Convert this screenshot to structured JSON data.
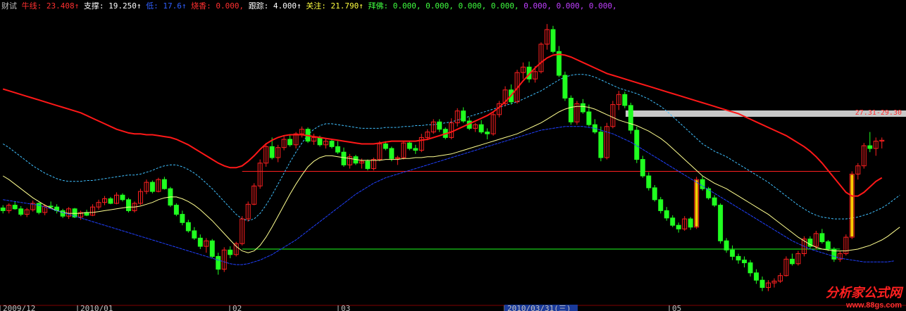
{
  "header": {
    "title": "财试",
    "items": [
      {
        "label": "牛线",
        "value": "23.408",
        "arrow": "↑",
        "color": "#ff3030"
      },
      {
        "label": "支撑",
        "value": "19.250",
        "arrow": "↑",
        "color": "#ffffff"
      },
      {
        "label": "低",
        "value": "17.6",
        "arrow": "↑",
        "color": "#3060ff"
      },
      {
        "label": "烧香",
        "value": "0.000",
        "arrow": ",",
        "color": "#ff3030"
      },
      {
        "label": "跟踪",
        "value": "4.000",
        "arrow": "↑",
        "color": "#ffffff"
      },
      {
        "label": "关注",
        "value": "21.790",
        "arrow": "↑",
        "color": "#ffff40"
      },
      {
        "label": "拜佛",
        "value": "0.000, 0.000, 0.000, 0.000,",
        "arrow": "",
        "color": "#40ff40"
      },
      {
        "label": "",
        "value": "0.000, 0.000, 0.000,",
        "arrow": "",
        "color": "#c040ff"
      }
    ]
  },
  "x_axis": {
    "ticks": [
      "2009/12",
      "2010/01",
      "02",
      "03",
      "2010/03/31(三)",
      "05"
    ]
  },
  "price_box_label": "27.31-29.30",
  "watermark": {
    "title": "分析家公式网",
    "url": "www.88gs.com"
  },
  "colors": {
    "up": "#ff2020",
    "down": "#20ff20",
    "special": "#ffcc00",
    "bull_line": "#ff1818",
    "support": "#ffff90",
    "low": "#2040ff",
    "track": "#40c0ff"
  },
  "chart_data": {
    "type": "candlestick",
    "ylim": [
      5,
      37
    ],
    "candles": [
      [
        15.5,
        15.8,
        14.9,
        15.2
      ],
      [
        15.2,
        16.0,
        14.9,
        15.8
      ],
      [
        15.8,
        16.2,
        15.3,
        15.4
      ],
      [
        15.4,
        15.7,
        14.6,
        14.8
      ],
      [
        14.8,
        15.5,
        14.5,
        15.3
      ],
      [
        15.3,
        16.3,
        15.1,
        16.0
      ],
      [
        16.0,
        16.1,
        14.8,
        15.0
      ],
      [
        15.0,
        15.9,
        14.7,
        15.7
      ],
      [
        15.7,
        16.2,
        15.5,
        15.6
      ],
      [
        15.6,
        15.9,
        14.9,
        15.2
      ],
      [
        15.2,
        15.4,
        14.4,
        14.6
      ],
      [
        14.6,
        15.6,
        14.3,
        15.4
      ],
      [
        15.4,
        15.5,
        14.4,
        14.5
      ],
      [
        14.5,
        15.2,
        14.2,
        15.0
      ],
      [
        15.0,
        15.3,
        14.6,
        14.7
      ],
      [
        14.7,
        15.9,
        14.6,
        15.6
      ],
      [
        15.6,
        16.4,
        15.3,
        16.1
      ],
      [
        16.1,
        16.8,
        15.8,
        16.5
      ],
      [
        16.5,
        16.7,
        15.9,
        16.0
      ],
      [
        16.0,
        17.2,
        15.9,
        16.9
      ],
      [
        16.9,
        17.1,
        16.2,
        16.4
      ],
      [
        16.4,
        16.6,
        15.0,
        15.2
      ],
      [
        15.2,
        16.2,
        15.0,
        16.0
      ],
      [
        16.0,
        17.6,
        15.8,
        17.3
      ],
      [
        17.3,
        18.6,
        17.0,
        18.3
      ],
      [
        18.3,
        18.5,
        17.1,
        17.3
      ],
      [
        17.3,
        18.8,
        17.2,
        18.6
      ],
      [
        18.6,
        18.9,
        17.5,
        17.6
      ],
      [
        17.6,
        17.8,
        15.6,
        15.8
      ],
      [
        15.8,
        16.0,
        14.6,
        14.8
      ],
      [
        14.8,
        15.2,
        13.6,
        13.9
      ],
      [
        13.9,
        14.2,
        12.8,
        13.0
      ],
      [
        13.0,
        13.4,
        12.0,
        12.2
      ],
      [
        12.2,
        12.6,
        11.0,
        11.3
      ],
      [
        11.3,
        12.2,
        10.6,
        11.9
      ],
      [
        11.9,
        12.1,
        10.0,
        10.2
      ],
      [
        10.2,
        10.6,
        8.2,
        8.8
      ],
      [
        8.8,
        11.2,
        8.5,
        10.9
      ],
      [
        10.9,
        11.3,
        10.0,
        10.4
      ],
      [
        10.4,
        11.8,
        10.2,
        11.6
      ],
      [
        11.6,
        14.6,
        11.4,
        14.3
      ],
      [
        14.3,
        16.2,
        14.0,
        15.9
      ],
      [
        15.9,
        18.2,
        15.8,
        17.9
      ],
      [
        17.9,
        20.8,
        17.6,
        20.4
      ],
      [
        20.4,
        22.6,
        20.0,
        22.2
      ],
      [
        22.2,
        23.2,
        20.8,
        21.0
      ],
      [
        21.0,
        22.4,
        20.5,
        22.1
      ],
      [
        22.1,
        23.4,
        21.8,
        23.0
      ],
      [
        23.0,
        23.5,
        22.2,
        22.4
      ],
      [
        22.4,
        23.8,
        22.0,
        23.6
      ],
      [
        23.6,
        24.4,
        23.2,
        24.1
      ],
      [
        24.1,
        24.3,
        22.6,
        22.8
      ],
      [
        22.8,
        23.6,
        22.4,
        23.2
      ],
      [
        23.2,
        23.4,
        22.2,
        22.4
      ],
      [
        22.4,
        23.1,
        22.0,
        22.8
      ],
      [
        22.8,
        23.0,
        22.0,
        22.2
      ],
      [
        22.2,
        22.8,
        21.4,
        21.6
      ],
      [
        21.6,
        22.1,
        20.0,
        20.2
      ],
      [
        20.2,
        21.4,
        19.8,
        21.1
      ],
      [
        21.1,
        21.3,
        20.2,
        20.4
      ],
      [
        20.4,
        20.9,
        19.8,
        20.6
      ],
      [
        20.6,
        20.8,
        19.6,
        19.8
      ],
      [
        19.8,
        21.0,
        19.6,
        20.8
      ],
      [
        20.8,
        22.8,
        20.6,
        22.5
      ],
      [
        22.5,
        22.8,
        21.8,
        22.0
      ],
      [
        22.0,
        22.2,
        20.6,
        20.9
      ],
      [
        20.9,
        21.2,
        20.2,
        21.0
      ],
      [
        21.0,
        22.8,
        20.8,
        22.6
      ],
      [
        22.6,
        22.8,
        21.8,
        22.0
      ],
      [
        22.0,
        22.4,
        21.4,
        21.8
      ],
      [
        21.8,
        23.6,
        21.6,
        23.2
      ],
      [
        23.2,
        24.1,
        22.9,
        23.8
      ],
      [
        23.8,
        25.2,
        23.6,
        24.9
      ],
      [
        24.9,
        25.2,
        23.8,
        24.1
      ],
      [
        24.1,
        24.3,
        23.0,
        23.2
      ],
      [
        23.2,
        25.3,
        23.0,
        24.8
      ],
      [
        24.8,
        26.4,
        24.4,
        26.1
      ],
      [
        26.1,
        26.5,
        24.8,
        25.0
      ],
      [
        25.0,
        25.4,
        24.0,
        24.2
      ],
      [
        24.2,
        24.8,
        23.8,
        24.6
      ],
      [
        24.6,
        25.1,
        23.6,
        23.8
      ],
      [
        23.8,
        24.2,
        23.0,
        23.6
      ],
      [
        23.6,
        26.0,
        23.4,
        25.7
      ],
      [
        25.7,
        27.2,
        25.4,
        26.9
      ],
      [
        26.9,
        28.8,
        26.6,
        28.4
      ],
      [
        28.4,
        29.0,
        26.8,
        27.1
      ],
      [
        27.1,
        30.6,
        26.9,
        30.3
      ],
      [
        30.3,
        31.4,
        29.6,
        30.9
      ],
      [
        30.9,
        31.5,
        29.2,
        29.6
      ],
      [
        29.6,
        31.0,
        29.2,
        30.4
      ],
      [
        30.4,
        33.6,
        30.2,
        33.4
      ],
      [
        33.4,
        35.6,
        32.8,
        35.0
      ],
      [
        35.0,
        35.4,
        32.4,
        32.6
      ],
      [
        32.6,
        33.2,
        29.8,
        30.0
      ],
      [
        30.0,
        30.4,
        27.2,
        27.5
      ],
      [
        27.5,
        27.8,
        24.6,
        24.9
      ],
      [
        24.9,
        27.2,
        24.6,
        26.9
      ],
      [
        26.9,
        27.4,
        25.8,
        26.0
      ],
      [
        26.0,
        26.8,
        24.4,
        24.6
      ],
      [
        24.6,
        25.2,
        23.6,
        23.8
      ],
      [
        23.8,
        24.4,
        20.6,
        21.0
      ],
      [
        21.0,
        24.8,
        20.8,
        24.4
      ],
      [
        24.4,
        27.2,
        24.2,
        26.8
      ],
      [
        26.8,
        28.3,
        26.2,
        27.9
      ],
      [
        27.9,
        28.2,
        26.4,
        26.7
      ],
      [
        26.7,
        27.0,
        23.6,
        24.0
      ],
      [
        24.0,
        24.4,
        20.4,
        20.8
      ],
      [
        20.8,
        21.2,
        18.8,
        19.0
      ],
      [
        19.0,
        19.4,
        17.4,
        17.7
      ],
      [
        17.7,
        18.0,
        16.2,
        16.4
      ],
      [
        16.4,
        16.7,
        14.9,
        15.2
      ],
      [
        15.2,
        15.6,
        14.1,
        14.4
      ],
      [
        14.4,
        14.7,
        13.4,
        13.6
      ],
      [
        13.6,
        13.9,
        12.8,
        13.2
      ],
      [
        13.2,
        14.6,
        13.0,
        14.3
      ],
      [
        14.3,
        14.5,
        13.1,
        13.4
      ],
      [
        13.4,
        18.9,
        13.2,
        18.6
      ],
      [
        18.6,
        19.0,
        17.4,
        17.6
      ],
      [
        17.6,
        17.8,
        16.4,
        16.6
      ],
      [
        16.6,
        16.9,
        15.6,
        15.8
      ],
      [
        15.8,
        16.0,
        11.6,
        11.9
      ],
      [
        11.9,
        12.2,
        10.6,
        10.9
      ],
      [
        10.9,
        11.4,
        9.8,
        10.2
      ],
      [
        10.2,
        10.5,
        9.4,
        9.8
      ],
      [
        9.8,
        10.2,
        9.0,
        9.5
      ],
      [
        9.5,
        9.8,
        8.0,
        8.4
      ],
      [
        8.4,
        8.8,
        7.2,
        7.6
      ],
      [
        7.6,
        8.0,
        6.4,
        6.8
      ],
      [
        6.8,
        7.6,
        6.4,
        7.3
      ],
      [
        7.3,
        7.8,
        6.8,
        7.5
      ],
      [
        7.5,
        8.4,
        7.3,
        8.1
      ],
      [
        8.1,
        10.2,
        8.0,
        9.9
      ],
      [
        9.9,
        10.5,
        9.2,
        9.4
      ],
      [
        9.4,
        10.8,
        9.2,
        10.5
      ],
      [
        10.5,
        12.4,
        10.2,
        12.1
      ],
      [
        12.1,
        12.4,
        11.0,
        11.3
      ],
      [
        11.3,
        13.0,
        11.0,
        12.7
      ],
      [
        12.7,
        13.2,
        11.6,
        11.8
      ],
      [
        11.8,
        12.0,
        10.8,
        11.0
      ],
      [
        11.0,
        11.2,
        9.6,
        9.9
      ],
      [
        9.9,
        10.8,
        9.6,
        10.5
      ],
      [
        10.5,
        12.6,
        10.3,
        12.3
      ],
      [
        12.3,
        19.5,
        12.1,
        19.2
      ],
      [
        19.2,
        20.4,
        18.6,
        20.1
      ],
      [
        20.1,
        22.6,
        19.8,
        22.3
      ],
      [
        22.3,
        23.8,
        21.6,
        22.0
      ],
      [
        22.0,
        23.2,
        21.2,
        22.8
      ],
      [
        22.8,
        23.2,
        22.0,
        22.9
      ]
    ],
    "series": [
      {
        "name": "牛线",
        "values": [
          28.5,
          28.3,
          28.1,
          27.9,
          27.7,
          27.5,
          27.3,
          27.1,
          26.9,
          26.7,
          26.5,
          26.3,
          26.1,
          25.9,
          25.6,
          25.3,
          25.0,
          24.7,
          24.4,
          24.1,
          23.9,
          23.7,
          23.6,
          23.6,
          23.5,
          23.5,
          23.4,
          23.3,
          23.2,
          23.0,
          22.7,
          22.4,
          22.0,
          21.6,
          21.2,
          20.8,
          20.4,
          20.1,
          19.9,
          19.9,
          20.1,
          20.6,
          21.2,
          21.9,
          22.5,
          22.9,
          23.2,
          23.4,
          23.5,
          23.5,
          23.5,
          23.4,
          23.3,
          23.2,
          23.1,
          23.0,
          22.9,
          22.8,
          22.7,
          22.6,
          22.5,
          22.5,
          22.5,
          22.6,
          22.7,
          22.8,
          22.8,
          22.8,
          22.8,
          22.8,
          22.9,
          23.0,
          23.2,
          23.4,
          23.6,
          23.8,
          24.1,
          24.4,
          24.7,
          25.0,
          25.3,
          25.6,
          26.0,
          26.5,
          27.1,
          27.8,
          28.6,
          29.4,
          30.1,
          30.8,
          31.4,
          31.9,
          32.2,
          32.3,
          32.2,
          32.0,
          31.7,
          31.4,
          31.1,
          30.8,
          30.5,
          30.2,
          30.0,
          29.8,
          29.6,
          29.4,
          29.2,
          29.0,
          28.8,
          28.6,
          28.4,
          28.2,
          28.0,
          27.8,
          27.6,
          27.4,
          27.2,
          27.0,
          26.8,
          26.6,
          26.4,
          26.2,
          26.0,
          25.8,
          25.5,
          25.2,
          24.9,
          24.6,
          24.3,
          24.0,
          23.7,
          23.4,
          23.0,
          22.6,
          22.2,
          21.7,
          21.1,
          20.4,
          19.6,
          18.8,
          18.0,
          17.2,
          16.8,
          16.8,
          17.2,
          17.8,
          18.4,
          18.8
        ]
      },
      {
        "name": "支撑",
        "values": [
          19.0,
          18.6,
          18.1,
          17.6,
          17.1,
          16.6,
          16.2,
          15.8,
          15.5,
          15.2,
          15.0,
          14.9,
          14.9,
          14.9,
          15.0,
          15.0,
          15.1,
          15.2,
          15.3,
          15.4,
          15.5,
          15.6,
          15.6,
          15.7,
          15.9,
          16.1,
          16.4,
          16.6,
          16.7,
          16.7,
          16.5,
          16.2,
          15.8,
          15.3,
          14.7,
          14.1,
          13.4,
          12.7,
          12.0,
          11.3,
          10.8,
          10.6,
          10.8,
          11.4,
          12.3,
          13.4,
          14.6,
          15.8,
          17.0,
          18.1,
          19.1,
          20.0,
          20.6,
          21.0,
          21.2,
          21.2,
          21.1,
          21.0,
          20.9,
          20.8,
          20.7,
          20.7,
          20.7,
          20.7,
          20.8,
          20.8,
          20.8,
          20.9,
          20.9,
          21.0,
          21.0,
          21.1,
          21.1,
          21.2,
          21.3,
          21.4,
          21.6,
          21.8,
          22.0,
          22.2,
          22.4,
          22.6,
          22.8,
          23.0,
          23.2,
          23.4,
          23.6,
          23.9,
          24.2,
          24.5,
          24.8,
          25.2,
          25.6,
          26.0,
          26.3,
          26.5,
          26.6,
          26.6,
          26.5,
          26.3,
          26.0,
          25.7,
          25.4,
          25.1,
          24.9,
          24.7,
          24.5,
          24.2,
          23.9,
          23.5,
          23.1,
          22.6,
          22.0,
          21.4,
          20.8,
          20.2,
          19.6,
          19.0,
          18.6,
          18.2,
          17.9,
          17.6,
          17.2,
          16.8,
          16.4,
          16.0,
          15.6,
          15.2,
          14.8,
          14.3,
          13.8,
          13.3,
          12.8,
          12.3,
          11.9,
          11.5,
          11.2,
          11.0,
          10.9,
          10.8,
          10.8,
          10.8,
          10.9,
          11.0,
          11.2,
          11.4,
          11.7,
          12.0,
          12.4,
          12.9,
          13.4
        ]
      },
      {
        "name": "低",
        "values": [
          16.4,
          16.3,
          16.2,
          16.1,
          16.0,
          15.9,
          15.8,
          15.6,
          15.4,
          15.2,
          15.0,
          14.8,
          14.6,
          14.4,
          14.2,
          14.0,
          13.8,
          13.6,
          13.4,
          13.2,
          13.0,
          12.8,
          12.6,
          12.4,
          12.2,
          12.0,
          11.8,
          11.6,
          11.4,
          11.2,
          11.0,
          10.8,
          10.6,
          10.4,
          10.2,
          10.0,
          9.8,
          9.6,
          9.4,
          9.3,
          9.3,
          9.4,
          9.6,
          9.8,
          10.1,
          10.4,
          10.8,
          11.2,
          11.6,
          12.0,
          12.5,
          13.0,
          13.5,
          14.0,
          14.5,
          15.0,
          15.5,
          16.0,
          16.5,
          17.0,
          17.4,
          17.8,
          18.2,
          18.5,
          18.8,
          19.0,
          19.2,
          19.4,
          19.6,
          19.8,
          20.0,
          20.2,
          20.4,
          20.6,
          20.8,
          21.0,
          21.2,
          21.4,
          21.6,
          21.8,
          22.0,
          22.2,
          22.4,
          22.6,
          22.8,
          23.0,
          23.2,
          23.4,
          23.6,
          23.8,
          24.0,
          24.1,
          24.2,
          24.3,
          24.4,
          24.4,
          24.4,
          24.4,
          24.3,
          24.2,
          24.0,
          23.8,
          23.6,
          23.3,
          23.0,
          22.7,
          22.3,
          21.9,
          21.5,
          21.1,
          20.7,
          20.3,
          19.9,
          19.5,
          19.1,
          18.7,
          18.3,
          17.9,
          17.5,
          17.1,
          16.7,
          16.3,
          15.9,
          15.5,
          15.1,
          14.7,
          14.3,
          13.9,
          13.5,
          13.1,
          12.7,
          12.3,
          11.9,
          11.6,
          11.3,
          11.0,
          10.8,
          10.6,
          10.4,
          10.2,
          10.0,
          9.9,
          9.8,
          9.7,
          9.6,
          9.6,
          9.6,
          9.6,
          9.6,
          9.7
        ]
      }
    ],
    "reference_lines": [
      {
        "y": 19.5,
        "color": "#ff2020"
      },
      {
        "y": 11.0,
        "color": "#20ff20"
      }
    ]
  }
}
